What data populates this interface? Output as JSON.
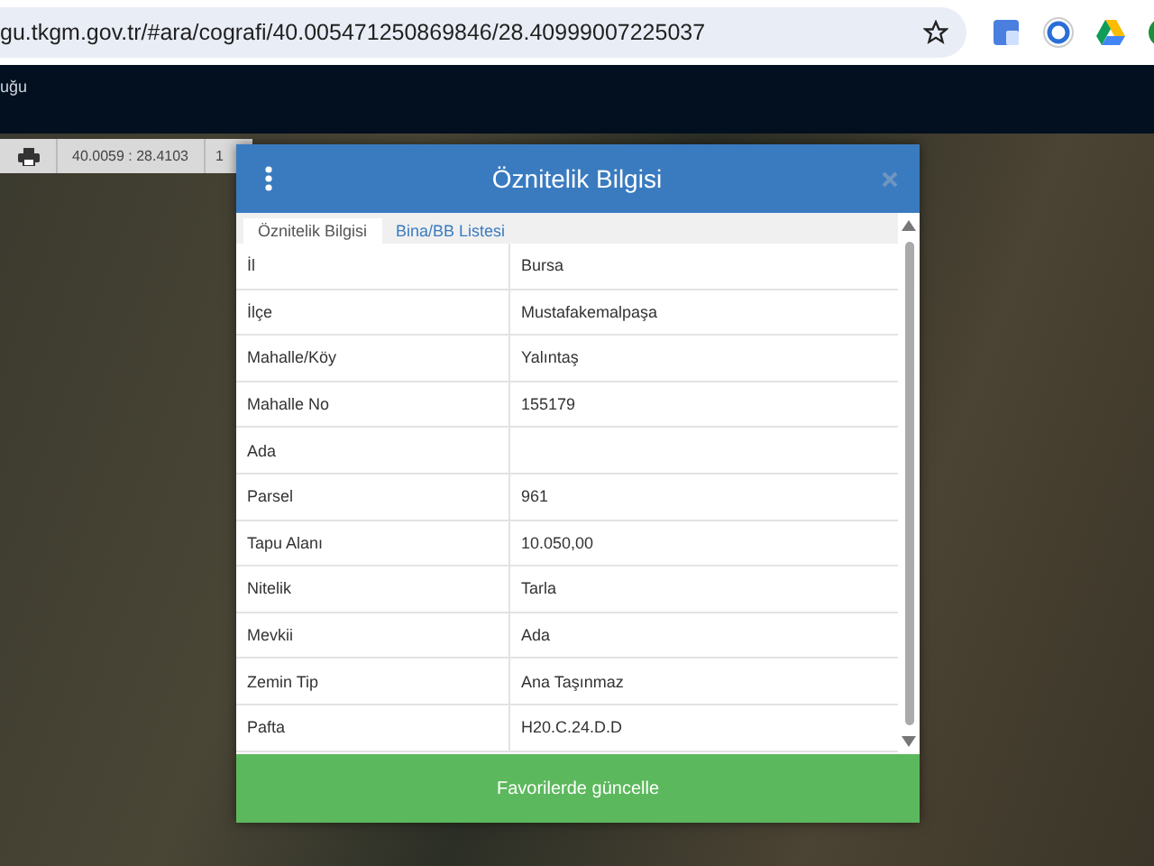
{
  "browser": {
    "url": "gu.tkgm.gov.tr/#ara/cografi/40.005471250869846/28.40999007225037"
  },
  "header": {
    "title": "uğu"
  },
  "map_toolbar": {
    "coordinates": "40.0059 : 28.4103",
    "zoom": "1"
  },
  "dialog": {
    "title": "Öznitelik Bilgisi",
    "tabs": [
      {
        "label": "Öznitelik Bilgisi",
        "selected": true
      },
      {
        "label": "Bina/BB Listesi",
        "selected": false
      }
    ],
    "rows": [
      {
        "label": "İl",
        "value": "Bursa"
      },
      {
        "label": "İlçe",
        "value": "Mustafakemalpaşa"
      },
      {
        "label": "Mahalle/Köy",
        "value": "Yalıntaş"
      },
      {
        "label": "Mahalle No",
        "value": "155179"
      },
      {
        "label": "Ada",
        "value": ""
      },
      {
        "label": "Parsel",
        "value": "961"
      },
      {
        "label": "Tapu Alanı",
        "value": "10.050,00"
      },
      {
        "label": "Nitelik",
        "value": "Tarla"
      },
      {
        "label": "Mevkii",
        "value": "Ada"
      },
      {
        "label": "Zemin Tip",
        "value": "Ana Taşınmaz"
      },
      {
        "label": "Pafta",
        "value": "H20.C.24.D.D"
      }
    ],
    "button": "Favorilerde güncelle"
  }
}
